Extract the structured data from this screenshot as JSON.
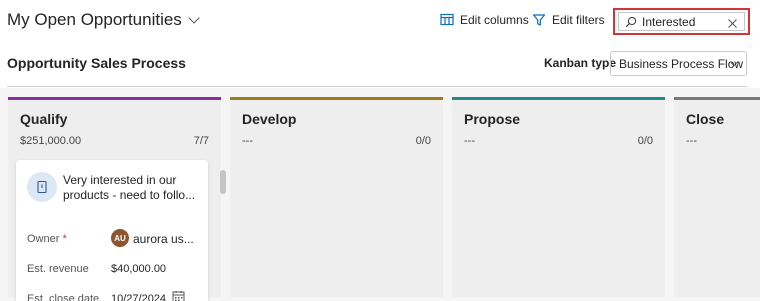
{
  "header": {
    "view_title": "My Open Opportunities",
    "edit_columns_label": "Edit columns",
    "edit_filters_label": "Edit filters",
    "search_value": "Interested"
  },
  "subheader": {
    "process_title": "Opportunity Sales Process",
    "kanban_type_label": "Kanban type",
    "kanban_type_value": "Business Process Flow"
  },
  "columns": [
    {
      "name": "Qualify",
      "amount": "$251,000.00",
      "count": "7/7",
      "accent": "#8b2f9f"
    },
    {
      "name": "Develop",
      "amount": "---",
      "count": "0/0",
      "accent": "#9c7c1e"
    },
    {
      "name": "Propose",
      "amount": "---",
      "count": "0/0",
      "accent": "#1f8a8a"
    },
    {
      "name": "Close",
      "amount": "---",
      "count": "",
      "accent": "#7a7a7a"
    }
  ],
  "card": {
    "title": "Very interested in our products - need to follo...",
    "owner_label": "Owner",
    "required_mark": "*",
    "owner_initials": "AU",
    "owner_name": "aurora us...",
    "revenue_label": "Est. revenue",
    "revenue_value": "$40,000.00",
    "close_label": "Est. close date",
    "close_value": "10/27/2024"
  },
  "colors": {
    "search_highlight": "#d13438",
    "toolbar_icon": "#0f6cbd",
    "avatar_bg": "#8e562e"
  }
}
